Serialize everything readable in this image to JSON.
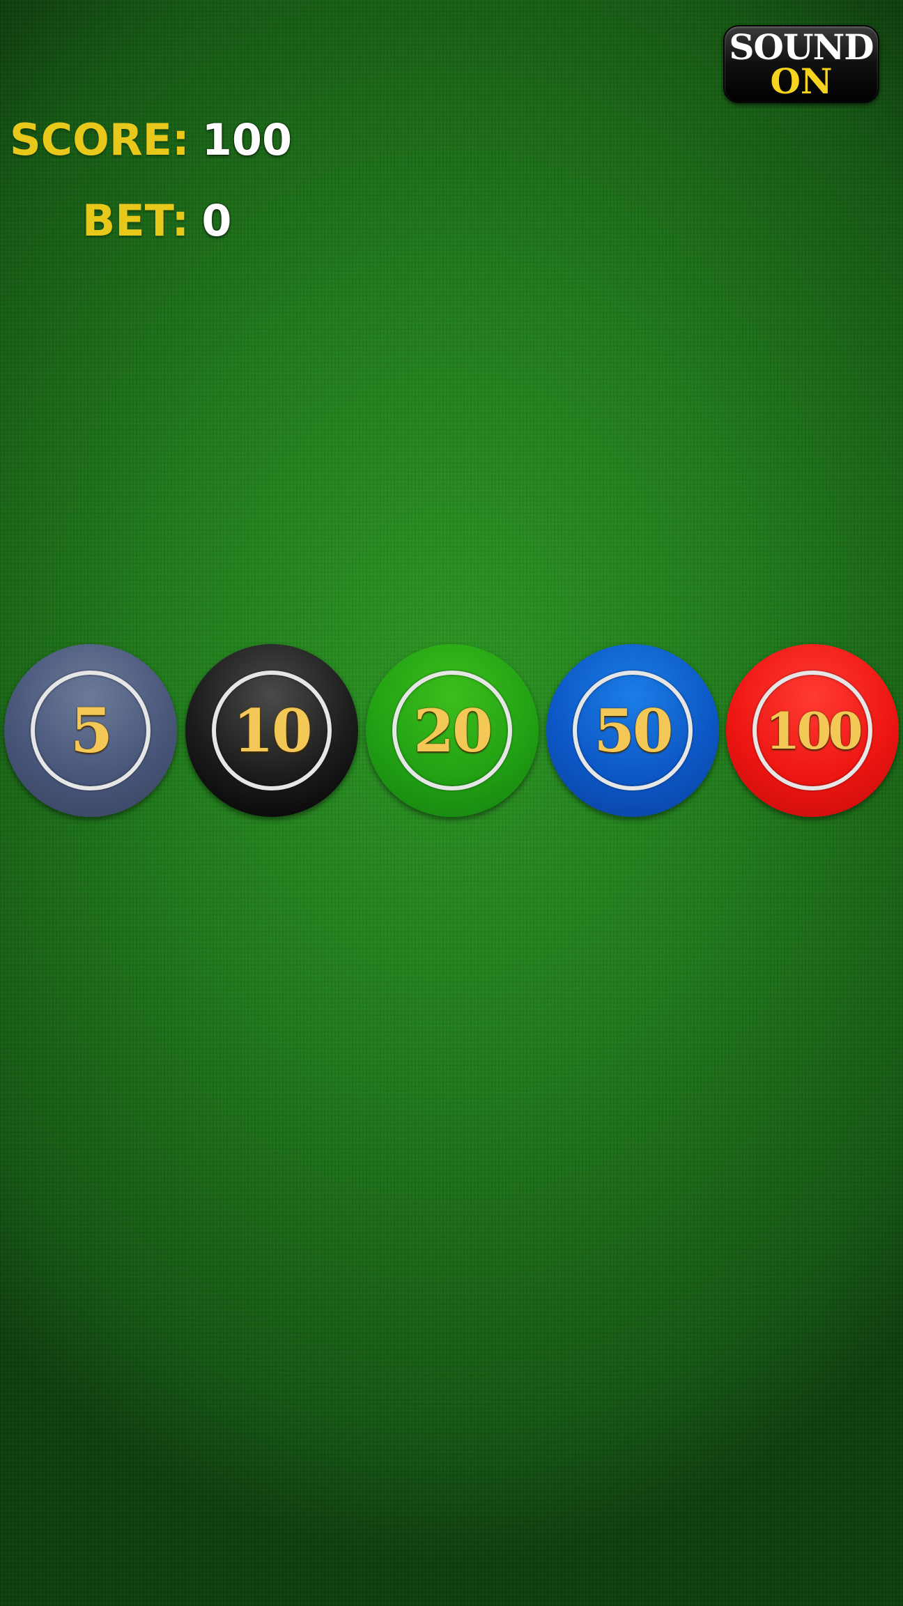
{
  "hud": {
    "score_label": "SCORE:",
    "score_value": "100",
    "bet_label": "BET:",
    "bet_value": "0"
  },
  "sound_button": {
    "line1": "SOUND",
    "line2": "ON"
  },
  "chips": [
    {
      "value": "5",
      "color": "#48567a"
    },
    {
      "value": "10",
      "color": "#1c1c1c"
    },
    {
      "value": "20",
      "color": "#22a114"
    },
    {
      "value": "50",
      "color": "#0c58c6"
    },
    {
      "value": "100",
      "color": "#ee1612"
    }
  ],
  "colors": {
    "table_felt": "#1f7a1a",
    "label_yellow": "#e8c81a",
    "chip_text_gold": "#f3c857"
  }
}
